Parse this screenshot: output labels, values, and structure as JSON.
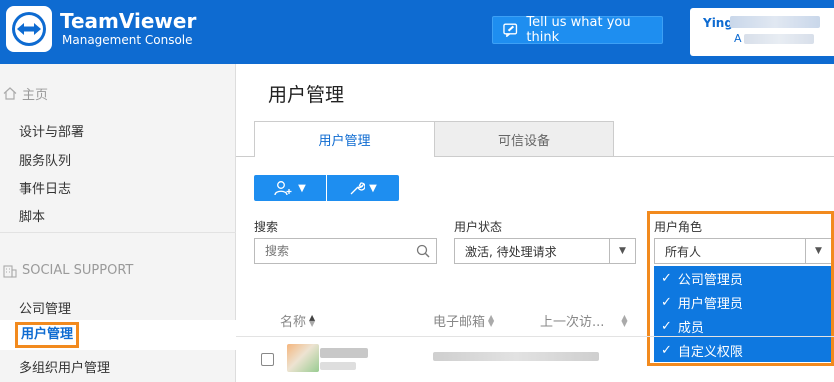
{
  "header": {
    "brand_title": "TeamViewer",
    "brand_subtitle": "Management Console",
    "feedback_label": "Tell us what you think",
    "user_name": "Ying",
    "user_sub": "A",
    "accent_color": "#0e6bd1"
  },
  "sidebar": {
    "home_label": "主页",
    "home_items": [
      "设计与部署",
      "服务队列",
      "事件日志",
      "脚本"
    ],
    "group_label": "SOCIAL SUPPORT",
    "group_items": [
      "公司管理",
      "用户管理",
      "多组织用户管理"
    ],
    "active_item": "用户管理"
  },
  "main": {
    "page_title": "用户管理",
    "tabs": [
      {
        "label": "用户管理",
        "active": true
      },
      {
        "label": "可信设备",
        "active": false
      }
    ],
    "toolbar": {
      "add_user_icon": "add-user-icon",
      "wrench_icon": "wrench-icon"
    },
    "filters": {
      "search_label": "搜索",
      "search_placeholder": "搜索",
      "status_label": "用户状态",
      "status_value": "激活, 待处理请求",
      "role_label": "用户角色",
      "role_value": "所有人",
      "role_options": [
        "公司管理员",
        "用户管理员",
        "成员",
        "自定义权限"
      ]
    },
    "table": {
      "columns": [
        "名称",
        "电子邮箱",
        "上一次访..."
      ]
    }
  }
}
